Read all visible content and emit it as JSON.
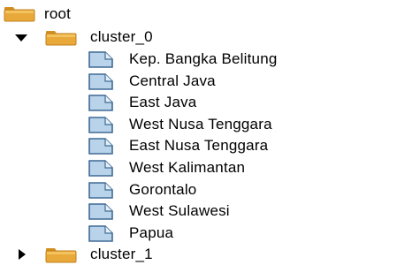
{
  "tree": {
    "root_label": "root",
    "clusters": [
      {
        "label": "cluster_0",
        "expanded": true,
        "items": [
          "Kep. Bangka Belitung",
          "Central Java",
          "East Java",
          "West Nusa Tenggara",
          "East Nusa Tenggara",
          "West Kalimantan",
          "Gorontalo",
          "West Sulawesi",
          "Papua"
        ]
      },
      {
        "label": "cluster_1",
        "expanded": false,
        "items": []
      }
    ]
  },
  "icons": {
    "folder": "folder-icon",
    "leaf": "document-icon",
    "expanded": "triangle-down-icon",
    "collapsed": "triangle-right-icon"
  },
  "colors": {
    "folder_fill": "#E8A93A",
    "folder_tab": "#D38F22",
    "doc_fill": "#B9D3EA",
    "doc_border": "#3E6A95",
    "text": "#000000"
  }
}
